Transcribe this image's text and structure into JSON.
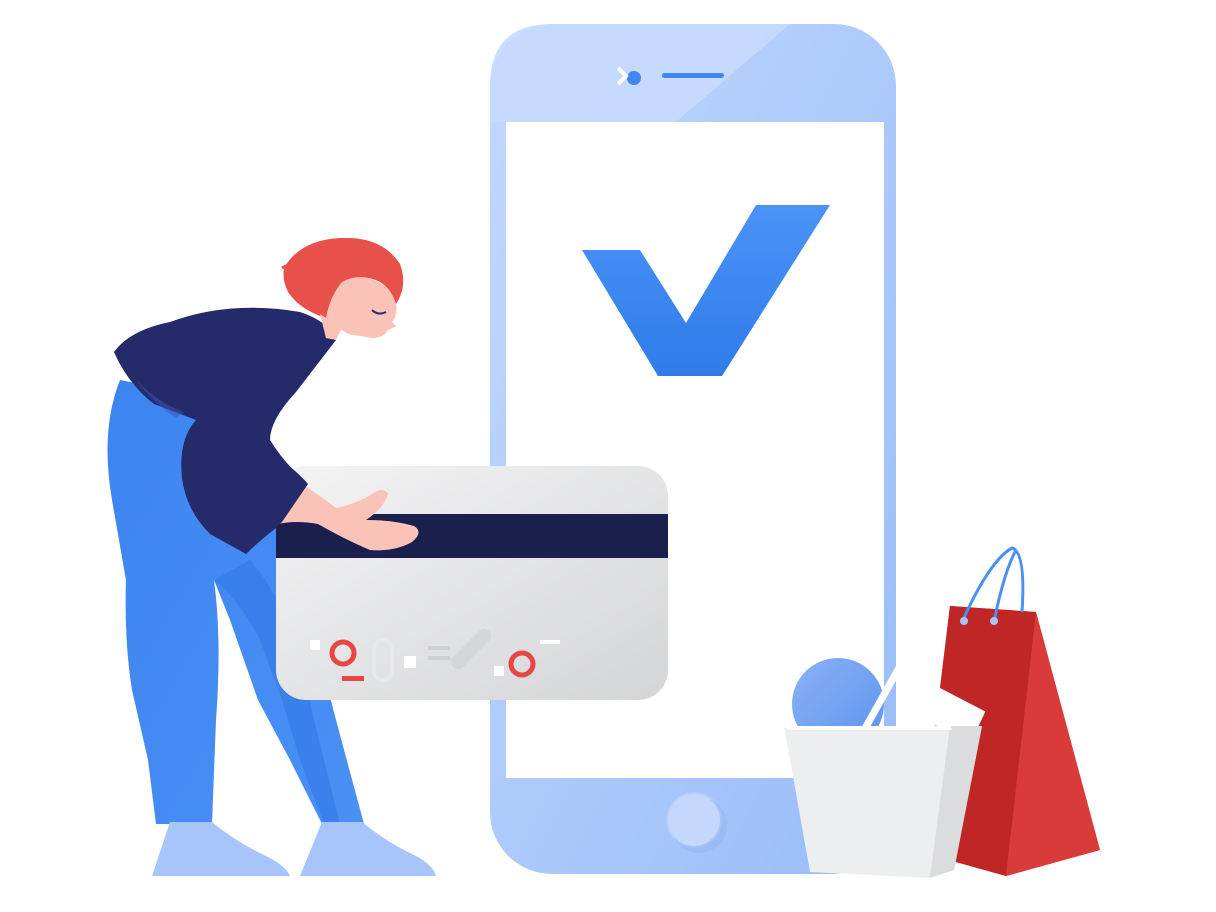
{
  "illustration": {
    "subject": "mobile-payment-success",
    "icons": [
      "check-icon",
      "credit-card",
      "phone",
      "shopping-bag",
      "person"
    ],
    "colors": {
      "phone_body": "#a9c6fb",
      "phone_body_light": "#c5d9fd",
      "screen": "#ffffff",
      "check": "#3d88f2",
      "card": "#e6e7e8",
      "card_stripe": "#1a1f4e",
      "card_accent": "#e84545",
      "shirt": "#252a6b",
      "pants": "#3f86f0",
      "hair": "#e8504a",
      "skin": "#fbc3b8",
      "shoes": "#a7c4fb",
      "bag_red": "#cc2a2a",
      "bag_white": "#eceeef"
    }
  }
}
